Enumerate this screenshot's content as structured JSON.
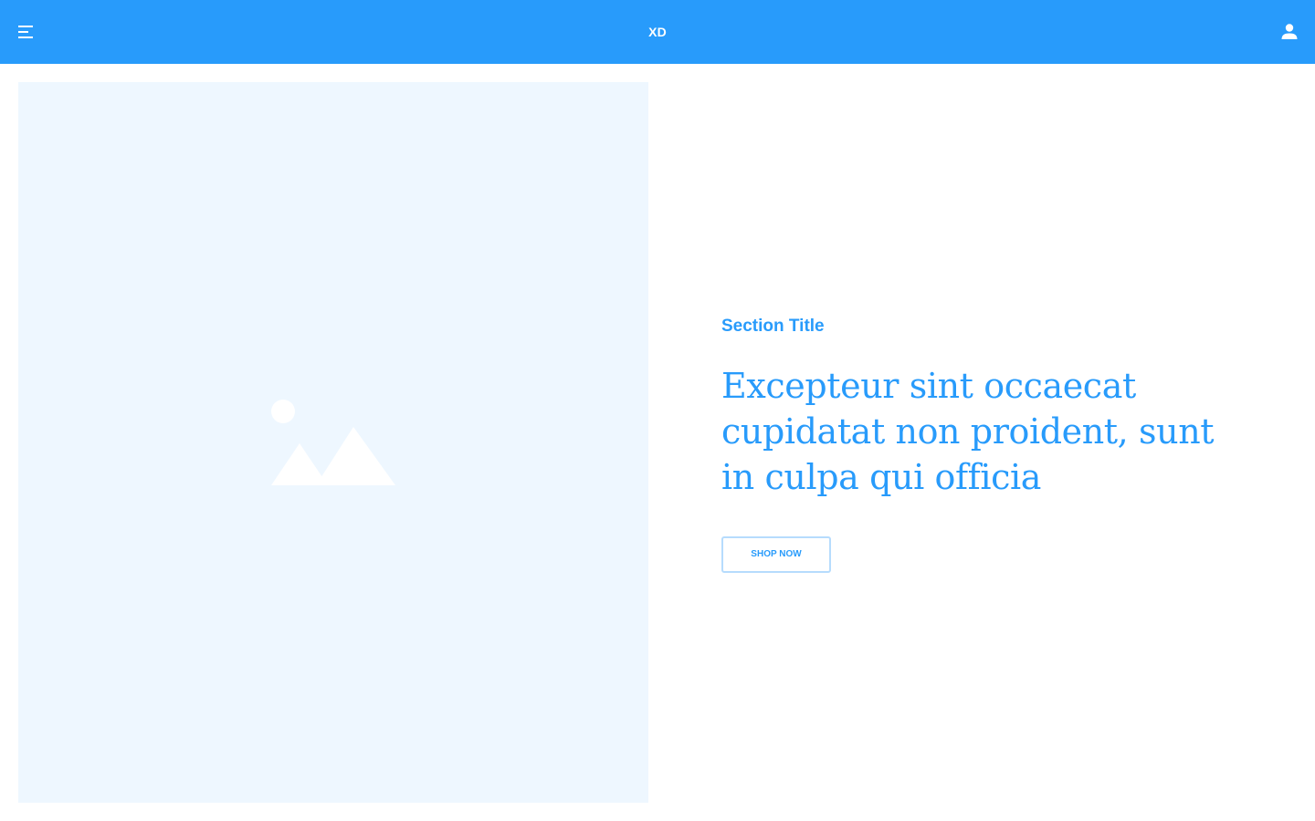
{
  "header": {
    "brand": "XD",
    "menu_icon": "hamburger-menu-icon",
    "account_icon": "user-account-icon",
    "background_color": "#289bfb"
  },
  "hero": {
    "image_icon": "image-placeholder-icon",
    "image_background_color": "#eef7ff",
    "section_title": "Section Title",
    "headline": "Excepteur sint occaecat cupidatat non proident, sunt in culpa qui officia",
    "button_label": "SHOP NOW",
    "accent_color": "#289bfb"
  }
}
